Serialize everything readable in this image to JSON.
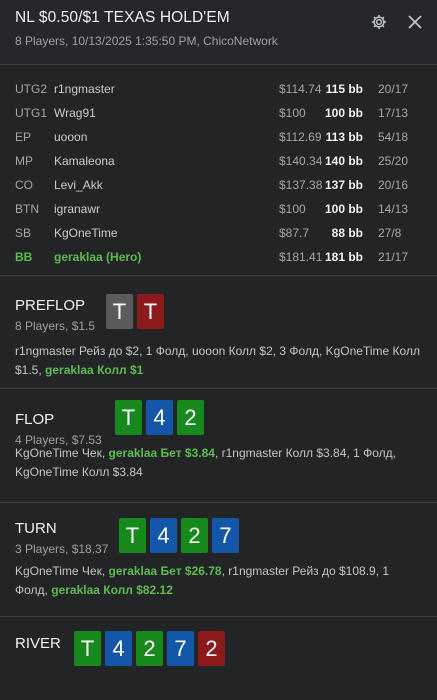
{
  "header": {
    "title": "NL $0.50/$1 TEXAS HOLD'EM",
    "subtitle": "8 Players, 10/13/2025 1:35:50 PM, ChicoNetwork",
    "settings_icon": "gear-icon",
    "close_icon": "close-icon"
  },
  "players": [
    {
      "position": "UTG2",
      "name": "r1ngmaster",
      "stack": "$114.74",
      "bb": "115 bb",
      "ratio": "20/17",
      "hero": false
    },
    {
      "position": "UTG1",
      "name": "Wrag91",
      "stack": "$100",
      "bb": "100 bb",
      "ratio": "17/13",
      "hero": false
    },
    {
      "position": "EP",
      "name": "uooon",
      "stack": "$112.69",
      "bb": "113 bb",
      "ratio": "54/18",
      "hero": false
    },
    {
      "position": "MP",
      "name": "Kamaleona",
      "stack": "$140.34",
      "bb": "140 bb",
      "ratio": "25/20",
      "hero": false
    },
    {
      "position": "CO",
      "name": "Levi_Akk",
      "stack": "$137.38",
      "bb": "137 bb",
      "ratio": "20/16",
      "hero": false
    },
    {
      "position": "BTN",
      "name": "igranawr",
      "stack": "$100",
      "bb": "100 bb",
      "ratio": "14/13",
      "hero": false
    },
    {
      "position": "SB",
      "name": "KgOneTime",
      "stack": "$87.7",
      "bb": "88 bb",
      "ratio": "27/8",
      "hero": false
    },
    {
      "position": "BB",
      "name": "geraklaa (Hero)",
      "stack": "$181.41",
      "bb": "181 bb",
      "ratio": "21/17",
      "hero": true
    }
  ],
  "streets": {
    "preflop": {
      "name": "PREFLOP",
      "info": "8 Players, $1.5",
      "cards": [
        {
          "rank": "T",
          "color": "#5b5b5b"
        },
        {
          "rank": "T",
          "color": "#8b1a1a"
        }
      ],
      "actions": "r1ngmaster Рейз до $2, 1 Фолд, uooon Колл $2, 3 Фолд, KgOneTime Колл $1.5, ",
      "hero_action": "geraklaa Колл $1"
    },
    "flop": {
      "name": "FLOP",
      "info": "4 Players, $7.53",
      "cards": [
        {
          "rank": "T",
          "color": "#18891d"
        },
        {
          "rank": "4",
          "color": "#1457a8"
        },
        {
          "rank": "2",
          "color": "#18891d"
        }
      ],
      "actions_before": "KgOneTime Чек, ",
      "hero_action": "geraklaa Бет $3.84",
      "actions_after": ", r1ngmaster Колл $3.84, 1 Фолд, KgOneTime Колл $3.84"
    },
    "turn": {
      "name": "TURN",
      "info": "3 Players, $18.37",
      "cards": [
        {
          "rank": "T",
          "color": "#18891d"
        },
        {
          "rank": "4",
          "color": "#1457a8"
        },
        {
          "rank": "2",
          "color": "#18891d"
        },
        {
          "rank": "7",
          "color": "#1457a8"
        }
      ],
      "actions_before": "KgOneTime Чек, ",
      "hero_action": "geraklaa Бет $26.78",
      "actions_middle": ", r1ngmaster Рейз до $108.9, 1 Фолд, ",
      "hero_action_2": "geraklaa Колл $82.12"
    },
    "river": {
      "name": "RIVER",
      "cards": [
        {
          "rank": "T",
          "color": "#18891d"
        },
        {
          "rank": "4",
          "color": "#1457a8"
        },
        {
          "rank": "2",
          "color": "#18891d"
        },
        {
          "rank": "7",
          "color": "#1457a8"
        },
        {
          "rank": "2",
          "color": "#8b1a1a"
        }
      ]
    }
  }
}
